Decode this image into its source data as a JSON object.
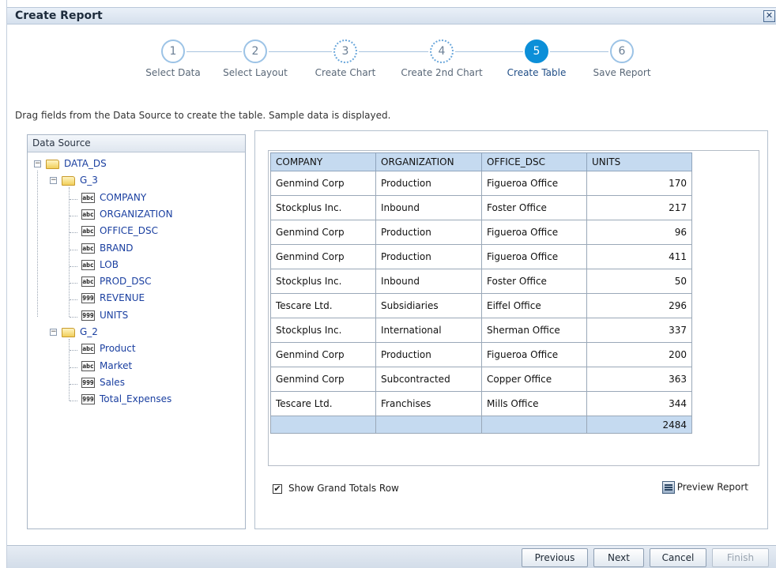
{
  "dialog": {
    "title": "Create Report",
    "close_glyph": "✕"
  },
  "train": {
    "steps": [
      {
        "number": "1",
        "label": "Select Data",
        "state": "visited"
      },
      {
        "number": "2",
        "label": "Select Layout",
        "state": "visited"
      },
      {
        "number": "3",
        "label": "Create Chart",
        "state": "optional"
      },
      {
        "number": "4",
        "label": "Create 2nd Chart",
        "state": "optional"
      },
      {
        "number": "5",
        "label": "Create Table",
        "state": "active"
      },
      {
        "number": "6",
        "label": "Save Report",
        "state": "unvisited"
      }
    ]
  },
  "instruction": "Drag fields from the Data Source to create the table. Sample data is displayed.",
  "data_source": {
    "header": "Data Source",
    "root": {
      "label": "DATA_DS",
      "expander": "−"
    },
    "groups": [
      {
        "label": "G_3",
        "expander": "−",
        "fields": [
          {
            "label": "COMPANY",
            "type": "abc"
          },
          {
            "label": "ORGANIZATION",
            "type": "abc"
          },
          {
            "label": "OFFICE_DSC",
            "type": "abc"
          },
          {
            "label": "BRAND",
            "type": "abc"
          },
          {
            "label": "LOB",
            "type": "abc"
          },
          {
            "label": "PROD_DSC",
            "type": "abc"
          },
          {
            "label": "REVENUE",
            "type": "999"
          },
          {
            "label": "UNITS",
            "type": "999"
          }
        ]
      },
      {
        "label": "G_2",
        "expander": "−",
        "fields": [
          {
            "label": "Product",
            "type": "abc"
          },
          {
            "label": "Market",
            "type": "abc"
          },
          {
            "label": "Sales",
            "type": "999"
          },
          {
            "label": "Total_Expenses",
            "type": "999"
          }
        ]
      }
    ]
  },
  "table": {
    "columns": [
      "COMPANY",
      "ORGANIZATION",
      "OFFICE_DSC",
      "UNITS"
    ],
    "rows": [
      [
        "Genmind Corp",
        "Production",
        "Figueroa Office",
        "170"
      ],
      [
        "Stockplus Inc.",
        "Inbound",
        "Foster Office",
        "217"
      ],
      [
        "Genmind Corp",
        "Production",
        "Figueroa Office",
        "96"
      ],
      [
        "Genmind Corp",
        "Production",
        "Figueroa Office",
        "411"
      ],
      [
        "Stockplus Inc.",
        "Inbound",
        "Foster Office",
        "50"
      ],
      [
        "Tescare Ltd.",
        "Subsidiaries",
        "Eiffel Office",
        "296"
      ],
      [
        "Stockplus Inc.",
        "International",
        "Sherman Office",
        "337"
      ],
      [
        "Genmind Corp",
        "Production",
        "Figueroa Office",
        "200"
      ],
      [
        "Genmind Corp",
        "Subcontracted",
        "Copper Office",
        "363"
      ],
      [
        "Tescare Ltd.",
        "Franchises",
        "Mills Office",
        "344"
      ]
    ],
    "totals": [
      "",
      "",
      "",
      "2484"
    ]
  },
  "options": {
    "grand_totals_label": "Show Grand Totals Row",
    "grand_totals_checked": true,
    "check_glyph": "✔",
    "preview_label": "Preview Report"
  },
  "buttons": {
    "previous": "Previous",
    "next": "Next",
    "cancel": "Cancel",
    "finish": "Finish"
  },
  "colors": {
    "active_step": "#0c8fd8",
    "table_header": "#c5daf0",
    "tree_text": "#1a3fa0"
  }
}
